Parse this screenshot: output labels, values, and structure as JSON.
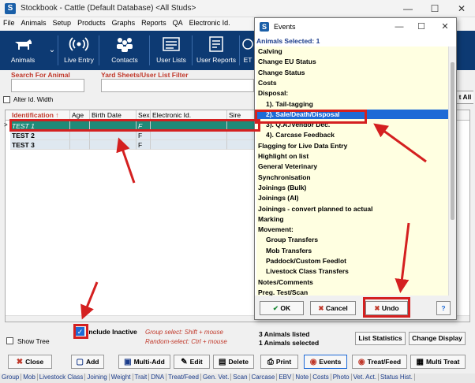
{
  "window": {
    "title": "Stockbook - Cattle (Default Database) <All Studs>",
    "app_icon": "S",
    "minimize": "—",
    "maximize": "☐",
    "close": "✕"
  },
  "menu": [
    "File",
    "Animals",
    "Setup",
    "Products",
    "Graphs",
    "Reports",
    "QA",
    "Electronic Id."
  ],
  "toolbar": [
    {
      "label": "Animals",
      "icon": "cow-icon"
    },
    {
      "label": "Live Entry",
      "icon": "signal-icon"
    },
    {
      "label": "Contacts",
      "icon": "contacts-icon"
    },
    {
      "label": "User Lists",
      "icon": "list-icon"
    },
    {
      "label": "User Reports",
      "icon": "report-icon"
    },
    {
      "label": "ET",
      "icon": "et-icon"
    }
  ],
  "filters": {
    "search_label": "Search For Animal",
    "yard_label": "Yard Sheets/User List Filter",
    "alter_id_label": "Alter Id. Width",
    "select_all_label": "t All"
  },
  "grid": {
    "columns": [
      "Identification",
      "Age",
      "Birth Date",
      "Sex",
      "Electronic Id.",
      "Sire"
    ],
    "rows": [
      {
        "id": "TEST 1",
        "age": "",
        "birth": "",
        "sex": "F",
        "eid": "",
        "sire": ""
      },
      {
        "id": "TEST 2",
        "age": "",
        "birth": "",
        "sex": "F",
        "eid": "",
        "sire": ""
      },
      {
        "id": "TEST 3",
        "age": "",
        "birth": "",
        "sex": "F",
        "eid": "",
        "sire": ""
      }
    ],
    "selected_marker": ">"
  },
  "bottom": {
    "include_inactive": "Include Inactive",
    "show_tree": "Show Tree",
    "group_select": "Group select: Shift + mouse",
    "random_select": "Random-select: Ctrl + mouse",
    "listed": "3 Animals listed",
    "selected": "1 Animals selected",
    "list_stats": "List Statistics",
    "change_display": "Change Display"
  },
  "actions": [
    {
      "label": "Close",
      "icon": "close-x-icon"
    },
    {
      "label": "Add",
      "icon": "add-icon"
    },
    {
      "label": "Multi-Add",
      "icon": "multi-add-icon"
    },
    {
      "label": "Edit",
      "icon": "edit-icon"
    },
    {
      "label": "Delete",
      "icon": "delete-icon"
    },
    {
      "label": "Print",
      "icon": "print-icon"
    },
    {
      "label": "Events",
      "icon": "events-icon"
    },
    {
      "label": "Treat/Feed",
      "icon": "treat-icon"
    },
    {
      "label": "Multi Treat",
      "icon": "multi-treat-icon"
    }
  ],
  "tabs": [
    "Group",
    "Mob",
    "Livestock Class",
    "Joining",
    "Weight",
    "Trait",
    "DNA",
    "Treat/Feed",
    "Gen. Vet.",
    "Scan",
    "Carcase",
    "EBV",
    "Note",
    "Costs",
    "Photo",
    "Vet. Act.",
    "Status Hist."
  ],
  "dialog": {
    "title": "Events",
    "selected_header": "Animals Selected:  1",
    "items": [
      {
        "label": "Calving",
        "sub": false
      },
      {
        "label": "Change EU Status",
        "sub": false
      },
      {
        "label": "Change Status",
        "sub": false
      },
      {
        "label": "Costs",
        "sub": false
      },
      {
        "label": "Disposal:",
        "sub": false
      },
      {
        "label": "1). Tail-tagging",
        "sub": true
      },
      {
        "label": "2). Sale/Death/Disposal",
        "sub": true
      },
      {
        "label": "3). Q.A./Vendor Dec.",
        "sub": true
      },
      {
        "label": "4). Carcase Feedback",
        "sub": true
      },
      {
        "label": "Flagging for Live Data Entry",
        "sub": false
      },
      {
        "label": "Highlight on list",
        "sub": false
      },
      {
        "label": "General Veterinary",
        "sub": false
      },
      {
        "label": "Synchronisation",
        "sub": false
      },
      {
        "label": "Joinings (Bulk)",
        "sub": false
      },
      {
        "label": "Joinings (AI)",
        "sub": false
      },
      {
        "label": "Joinings - convert planned to actual",
        "sub": false
      },
      {
        "label": "Marking",
        "sub": false
      },
      {
        "label": "Movement:",
        "sub": false
      },
      {
        "label": "Group Transfers",
        "sub": true
      },
      {
        "label": "Mob Transfers",
        "sub": true
      },
      {
        "label": "Paddock/Custom Feedlot",
        "sub": true
      },
      {
        "label": "Livestock Class Transfers",
        "sub": true
      },
      {
        "label": "Notes/Comments",
        "sub": false
      },
      {
        "label": "Preg. Test/Scan",
        "sub": false
      }
    ],
    "ok": "OK",
    "cancel": "Cancel",
    "undo": "Undo",
    "help": "?"
  },
  "colors": {
    "toolbar_bg": "#0d3a73",
    "selected_row": "#1f8a78",
    "list_bg": "#ffffe1",
    "list_selected": "#1e6ad6",
    "annotation_red": "#d42020"
  }
}
